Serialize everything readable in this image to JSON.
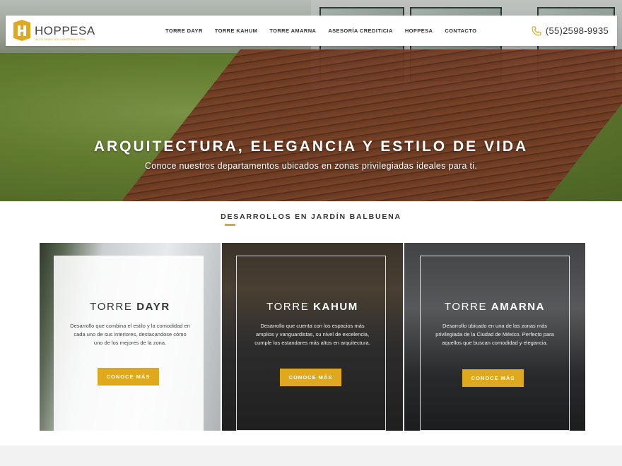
{
  "brand": {
    "name": "HOPPESA",
    "tagline": "ALTO NIVEL EN CONSTRUCCIÓN",
    "accent": "#e0a91d"
  },
  "nav": {
    "items": [
      "TORRE DAYR",
      "TORRE KAHUM",
      "TORRE AMARNA",
      "ASESORÍA CREDITICIA",
      "HOPPESA",
      "CONTACTO"
    ],
    "phone": "(55)2598-9935",
    "phone_icon": "phone-icon"
  },
  "hero": {
    "title": "ARQUITECTURA, ELEGANCIA Y ESTILO DE VIDA",
    "subtitle": "Conoce nuestros departamentos ubicados en zonas privilegiadas ideales para ti."
  },
  "section": {
    "title": "DESARROLLOS EN JARDÍN BALBUENA"
  },
  "cards": [
    {
      "title_light": "TORRE ",
      "title_bold": "DAYR",
      "description": "Desarrollo que combina el estilo y la comodidad en cada uno de sus interiores, destacandose cómo uno de los mejores de la zona.",
      "button": "CONOCE MÁS"
    },
    {
      "title_light": "TORRE ",
      "title_bold": "KAHUM",
      "description": "Desarrollo que cuenta con los espacios más amplios y vanguardistas, su nivel de excelencia, cumple los estandares más altos en arquitectura.",
      "button": "CONOCE MÁS"
    },
    {
      "title_light": "TORRE ",
      "title_bold": "AMARNA",
      "description": "Desarrollo ubicado en una de las zonas más privilegiada de la Ciudad de México. Perfecto para aquellos que buscan comodidad y elegancia.",
      "button": "CONOCE MÁS"
    }
  ]
}
